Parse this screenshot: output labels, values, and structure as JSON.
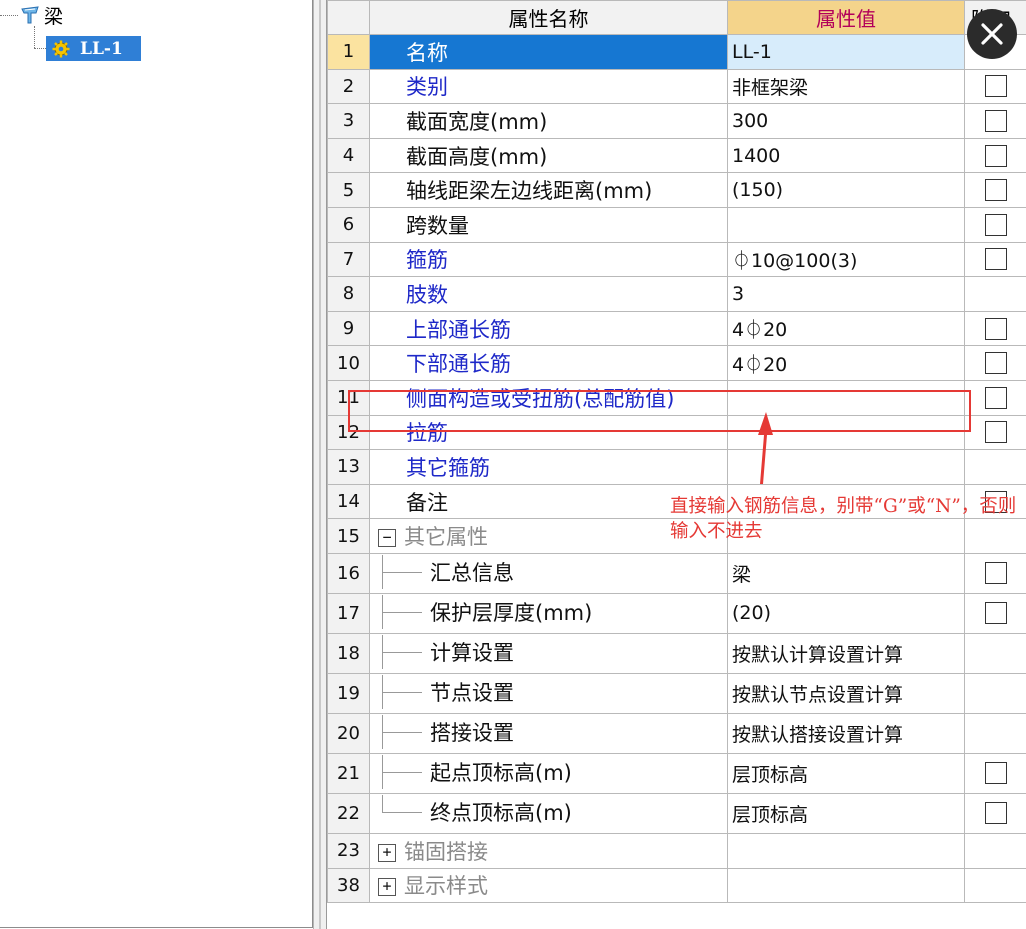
{
  "tree": {
    "root_label": "梁",
    "child_label": "LL-1"
  },
  "grid": {
    "headers": {
      "name": "属性名称",
      "value": "属性值",
      "extra": "附加"
    },
    "rows": [
      {
        "num": "1",
        "name": "名称",
        "value": "LL-1",
        "style": "blue",
        "check": false,
        "selected": true
      },
      {
        "num": "2",
        "name": "类别",
        "value": "非框架梁",
        "style": "blue",
        "check": true
      },
      {
        "num": "3",
        "name": "截面宽度(mm)",
        "value": "300",
        "style": "dark",
        "check": true
      },
      {
        "num": "4",
        "name": "截面高度(mm)",
        "value": "1400",
        "style": "dark",
        "check": true
      },
      {
        "num": "5",
        "name": "轴线距梁左边线距离(mm)",
        "value": "(150)",
        "style": "dark",
        "check": true
      },
      {
        "num": "6",
        "name": "跨数量",
        "value": "",
        "style": "dark",
        "check": true
      },
      {
        "num": "7",
        "name": "箍筋",
        "value": "⏀10@100(3)",
        "style": "blue",
        "check": true
      },
      {
        "num": "8",
        "name": "肢数",
        "value": "3",
        "style": "blue",
        "check": false
      },
      {
        "num": "9",
        "name": "上部通长筋",
        "value": "4⏀20",
        "style": "blue",
        "check": true
      },
      {
        "num": "10",
        "name": "下部通长筋",
        "value": "4⏀20",
        "style": "blue",
        "check": true
      },
      {
        "num": "11",
        "name": "侧面构造或受扭筋(总配筋值)",
        "value": "",
        "style": "blue",
        "check": true
      },
      {
        "num": "12",
        "name": "拉筋",
        "value": "",
        "style": "blue",
        "check": true
      },
      {
        "num": "13",
        "name": "其它箍筋",
        "value": "",
        "style": "blue",
        "check": false
      },
      {
        "num": "14",
        "name": "备注",
        "value": "",
        "style": "dark",
        "check": true
      },
      {
        "num": "15",
        "name": "其它属性",
        "value": "",
        "style": "group",
        "expander": "−",
        "check": false
      },
      {
        "num": "16",
        "name": "汇总信息",
        "value": "梁",
        "style": "child",
        "check": true
      },
      {
        "num": "17",
        "name": "保护层厚度(mm)",
        "value": "(20)",
        "style": "child",
        "check": true
      },
      {
        "num": "18",
        "name": "计算设置",
        "value": "按默认计算设置计算",
        "style": "child",
        "check": false
      },
      {
        "num": "19",
        "name": "节点设置",
        "value": "按默认节点设置计算",
        "style": "child",
        "check": false
      },
      {
        "num": "20",
        "name": "搭接设置",
        "value": "按默认搭接设置计算",
        "style": "child",
        "check": false
      },
      {
        "num": "21",
        "name": "起点顶标高(m)",
        "value": "层顶标高",
        "style": "child",
        "check": true
      },
      {
        "num": "22",
        "name": "终点顶标高(m)",
        "value": "层顶标高",
        "style": "child-last",
        "check": true
      },
      {
        "num": "23",
        "name": "锚固搭接",
        "value": "",
        "style": "group",
        "expander": "+",
        "check": false
      },
      {
        "num": "38",
        "name": "显示样式",
        "value": "",
        "style": "group",
        "expander": "+",
        "check": false
      }
    ]
  },
  "annotation": {
    "text": "直接输入钢筋信息，别带“G”或“N”，否则输入不进去"
  },
  "colors": {
    "selection": "#1677d2",
    "header_value_bg": "#f4d48b",
    "annotation_red": "#e53935",
    "link_blue": "#1e28c8"
  },
  "icons": {
    "close": "close-icon",
    "root": "beam-folder-icon",
    "child": "gear-icon"
  }
}
